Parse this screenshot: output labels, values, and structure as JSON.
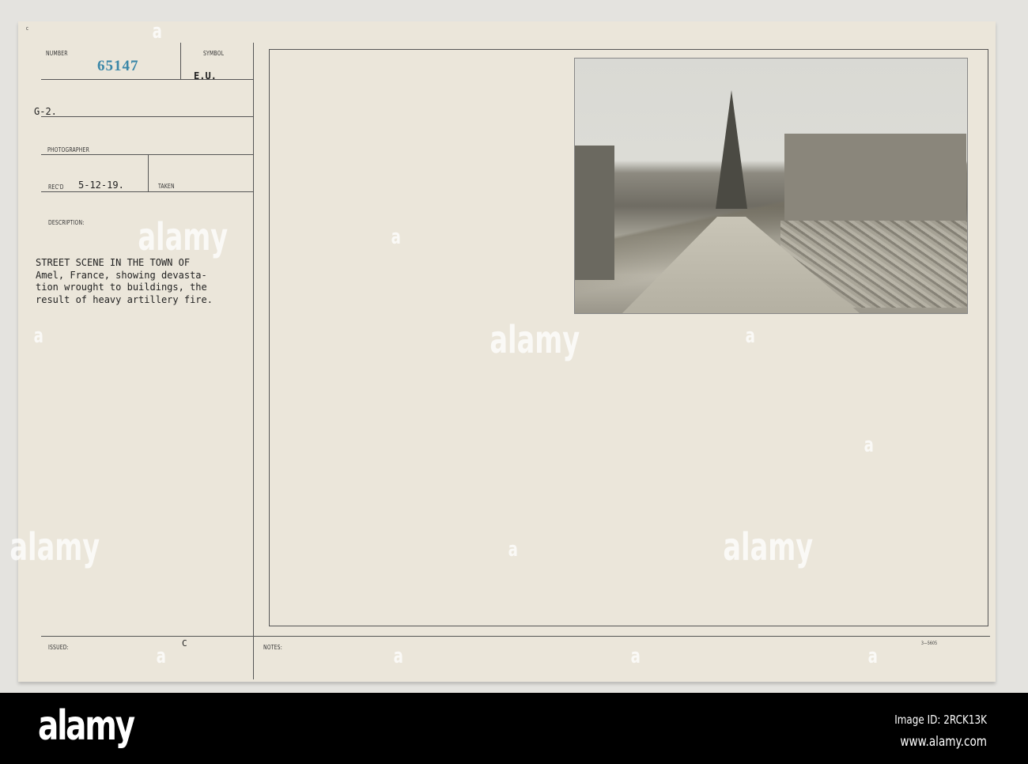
{
  "card": {
    "corner_mark": "c",
    "number_label": "NUMBER",
    "number_value": "65147",
    "symbol_label": "SYMBOL",
    "symbol_value": "E.U.",
    "unit": "G-2.",
    "photographer_label": "PHOTOGRAPHER",
    "recd_label": "REC'D",
    "recd_value": "5-12-19.",
    "taken_label": "TAKEN",
    "description_label": "DESCRIPTION:",
    "description_lines": [
      "STREET SCENE IN THE TOWN OF",
      "Amel, France, showing devasta-",
      "tion wrought to buildings, the",
      "result of heavy artillery fire."
    ],
    "issued_label": "ISSUED:",
    "issued_value": "C",
    "notes_label": "NOTES:",
    "form_code": "3—5605"
  },
  "watermark": {
    "text": "alamy",
    "small": "a"
  },
  "footer": {
    "logo": "alamy",
    "image_id": "Image ID: 2RCK13K",
    "url": "www.alamy.com"
  }
}
